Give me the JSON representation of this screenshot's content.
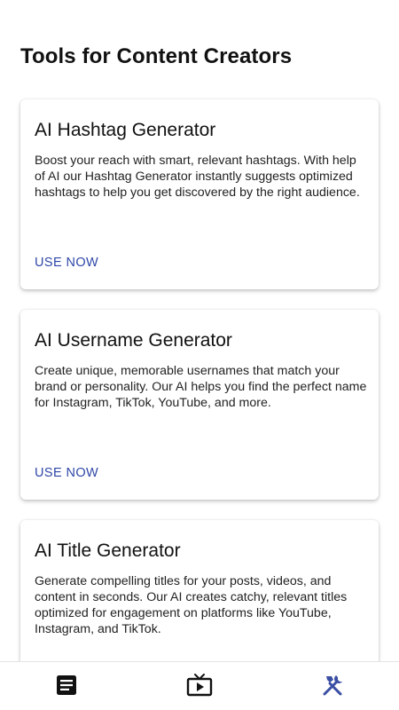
{
  "page": {
    "title": "Tools for Content Creators"
  },
  "cards": [
    {
      "title": "AI Hashtag Generator",
      "description": "Boost your reach with smart, relevant hashtags. With help of AI our Hashtag Generator instantly suggests optimized hashtags to help you get discovered by the right audience.",
      "action": "USE NOW"
    },
    {
      "title": "AI Username Generator",
      "description": "Create unique, memorable usernames that match your brand or personality. Our AI helps you find the perfect name for Instagram, TikTok, YouTube, and more.",
      "action": "USE NOW"
    },
    {
      "title": "AI Title Generator",
      "description": "Generate compelling titles for your posts, videos, and content in seconds. Our AI creates catchy, relevant titles optimized for engagement on platforms like YouTube, Instagram, and TikTok.",
      "action": ""
    }
  ],
  "bottom_nav": {
    "items": [
      {
        "icon": "article-icon",
        "active": false
      },
      {
        "icon": "tv-play-icon",
        "active": false
      },
      {
        "icon": "tools-icon",
        "active": true
      }
    ]
  },
  "colors": {
    "accent": "#2f47a8",
    "active_nav": "#3a4ea3",
    "icon": "#111111"
  }
}
